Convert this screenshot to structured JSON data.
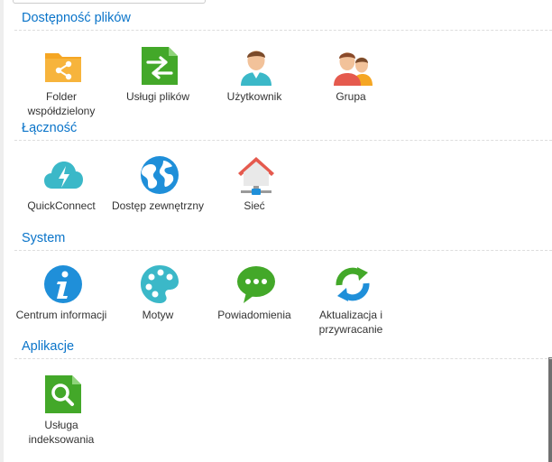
{
  "sections": [
    {
      "title": "Dostępność plików",
      "items": [
        {
          "label": "Folder współdzielony",
          "icon": "shared-folder-icon"
        },
        {
          "label": "Usługi plików",
          "icon": "file-services-icon"
        },
        {
          "label": "Użytkownik",
          "icon": "user-icon"
        },
        {
          "label": "Grupa",
          "icon": "group-icon"
        }
      ]
    },
    {
      "title": "Łączność",
      "items": [
        {
          "label": "QuickConnect",
          "icon": "quickconnect-cloud-icon"
        },
        {
          "label": "Dostęp zewnętrzny",
          "icon": "globe-icon"
        },
        {
          "label": "Sieć",
          "icon": "network-house-icon"
        }
      ]
    },
    {
      "title": "System",
      "items": [
        {
          "label": "Centrum informacji",
          "icon": "info-icon"
        },
        {
          "label": "Motyw",
          "icon": "palette-icon"
        },
        {
          "label": "Powiadomienia",
          "icon": "chat-bubble-icon"
        },
        {
          "label": "Aktualizacja i przywracanie",
          "icon": "update-arrows-icon"
        }
      ]
    },
    {
      "title": "Aplikacje",
      "items": [
        {
          "label": "Usługa indeksowania",
          "icon": "indexing-search-icon"
        }
      ]
    }
  ],
  "colors": {
    "section_title": "#0a74c9",
    "folder_orange": "#f5a623",
    "green": "#43a829",
    "teal": "#3bb8c8",
    "blue": "#1f8fd9",
    "red_roof": "#e55a4e"
  }
}
